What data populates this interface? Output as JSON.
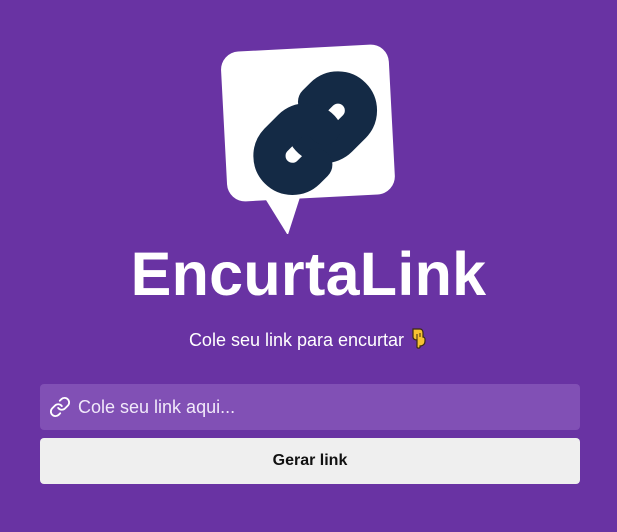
{
  "app": {
    "title": "EncurtaLink",
    "subtitle": "Cole seu link para encurtar",
    "subtitle_emoji": "👇",
    "logo_icon": "chain-link-speech-bubble-icon"
  },
  "form": {
    "input_icon": "link-icon",
    "input_value": "",
    "input_placeholder": "Cole seu link aqui...",
    "submit_label": "Gerar link"
  },
  "colors": {
    "background": "#6933a3",
    "input_background": "#8150b5",
    "button_background": "#efefef",
    "logo_background": "#ffffff",
    "logo_icon": "#142a45",
    "text": "#ffffff"
  }
}
